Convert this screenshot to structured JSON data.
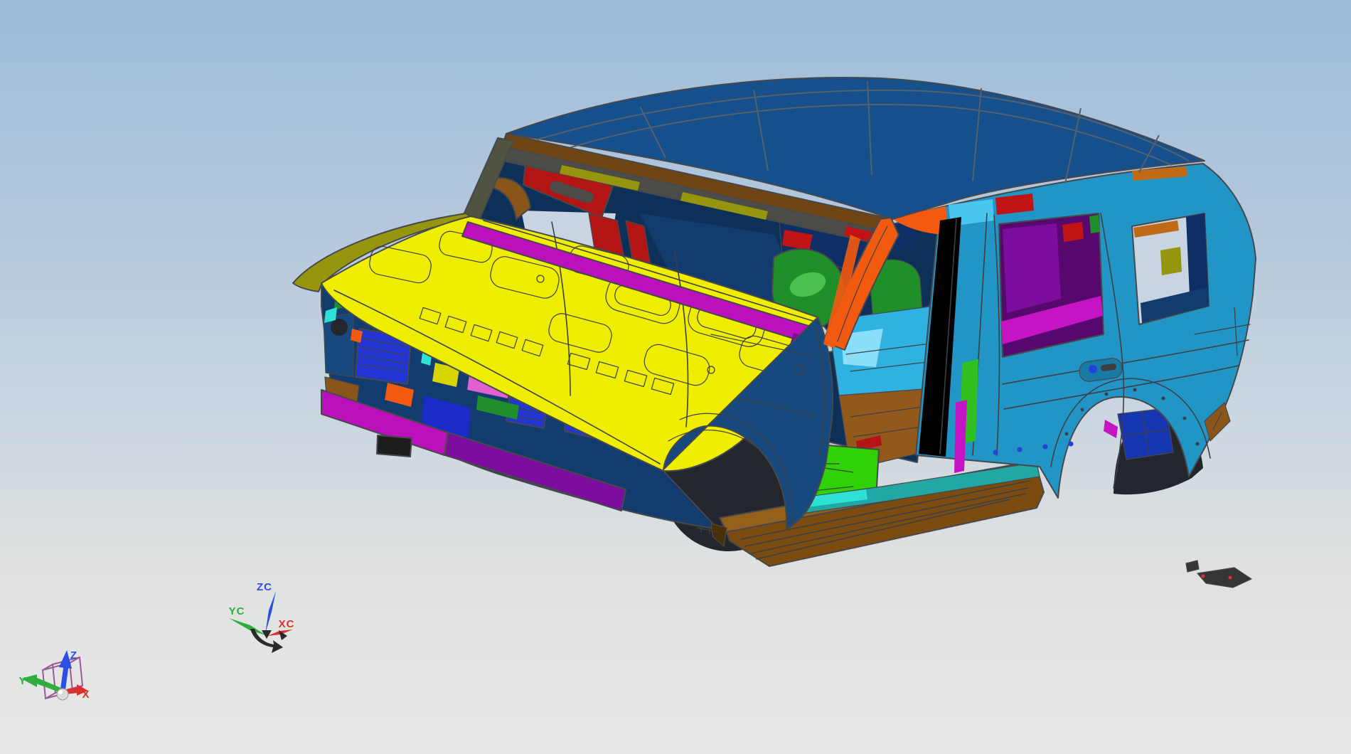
{
  "viewport": {
    "description": "3D CAD viewport showing a multi-colored SUV body-in-white sheet-metal assembly viewed from the front three-quarter above",
    "wcs_triad": {
      "z": "ZC",
      "y": "YC",
      "x": "XC"
    },
    "view_triad": {
      "z": "Z",
      "y": "Y",
      "x": "X"
    }
  },
  "colors": {
    "background_top": "#9cbddc",
    "background_mid": "#c8d4e1",
    "background_bottom": "#e9e9e7",
    "outline": "#46484c",
    "detail_line": "#3d3f43",
    "roof_line": "#54616e",
    "roof": "#15508c",
    "header_brown": "#6e4413",
    "header_dark": "#4b4b47",
    "olive": "#97950e",
    "olive_dark": "#50533f",
    "red": "#b31414",
    "red_bright": "#c01414",
    "orange": "#f25a10",
    "orange_brown": "#c06a18",
    "hood": "#efed00",
    "fender": "#16497e",
    "body": "#2196c6",
    "body_light": "#49c6ee",
    "interior_dark": "#0d3058",
    "dash_navy": "#123c6e",
    "navy_deep": "#0d2f66",
    "seat_green": "#1f8f2a",
    "green_bright": "#30c020",
    "green_light": "#58cc58",
    "floor_green": "#2fd305",
    "floor_cyan": "#2fb2e2",
    "floor_cyan_light": "#9ae8ff",
    "floor_brown": "#92591b",
    "rocker": "#7c4b10",
    "rocker_top": "#95601a",
    "rocker_dark": "#4a3008",
    "magenta": "#bb10bb",
    "magenta_bright": "#c414c4",
    "purple": "#7c0d9e",
    "purple_deep": "#56086e",
    "grille_blue": "#2336d4",
    "blue_deep": "#1b2bc8",
    "blue_royal": "#2244d4",
    "teal_sill": "#21a8a4",
    "cyan_bright": "#2fe0d4",
    "arch_navy": "#1536b0",
    "arch_dark": "#23262c",
    "pink": "#e060d0",
    "yellow_dim": "#d8d400",
    "brown": "#8a5518",
    "dark_part": "#353533",
    "black_part": "#1d1d1d",
    "wcs_z": "#2b4fe4",
    "wcs_y": "#2fae3e",
    "wcs_x": "#d93030",
    "cube_purple": "#9a5a9a",
    "sphere": "#dcdcda",
    "handle_black": "#2a2a28"
  }
}
